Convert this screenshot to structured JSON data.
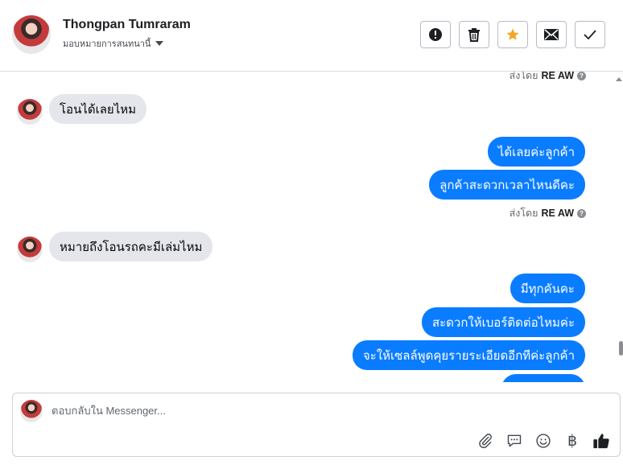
{
  "header": {
    "contact_name": "Thongpan Tumraram",
    "assign_label": "มอบหมายการสนทนานี้",
    "actions": [
      {
        "name": "mark-spam",
        "icon": "exclamation-circle-icon"
      },
      {
        "name": "delete",
        "icon": "trash-icon"
      },
      {
        "name": "star",
        "icon": "star-icon",
        "color": "#f5a623"
      },
      {
        "name": "mark-unread",
        "icon": "envelope-icon"
      },
      {
        "name": "mark-done",
        "icon": "checkmark-icon"
      }
    ]
  },
  "chat": {
    "sent_by_prefix": "ส่งโดย",
    "sent_by_name": "RE AW",
    "messages": [
      {
        "direction": "in",
        "text": "โอนได้เลยไหม"
      },
      {
        "direction": "out",
        "text": "ได้เลยค่ะลูกค้า"
      },
      {
        "direction": "out",
        "text": "ลูกค้าสะดวกเวลาไหนดีคะ"
      },
      {
        "direction": "in",
        "text": "หมายถึงโอนรถคะมีเล่มไหม"
      },
      {
        "direction": "out",
        "text": "มีทุกคันคะ"
      },
      {
        "direction": "out",
        "text": "สะดวกให้เบอร์ติดต่อไหมค่ะ"
      },
      {
        "direction": "out",
        "text": "จะให้เซลล์พูดคุยรายระเอียดอีกทีค่ะลูกค้า"
      }
    ]
  },
  "composer": {
    "placeholder": "ตอบกลับใน Messenger...",
    "value": "",
    "tools": [
      "paperclip-icon",
      "speech-bubble-icon",
      "smiley-icon",
      "baht-icon",
      "thumbs-up-icon"
    ],
    "currency_symbol": "฿"
  },
  "colors": {
    "outgoing_bubble": "#0a7cff",
    "incoming_bubble": "#e4e6eb",
    "star": "#f5a623"
  }
}
